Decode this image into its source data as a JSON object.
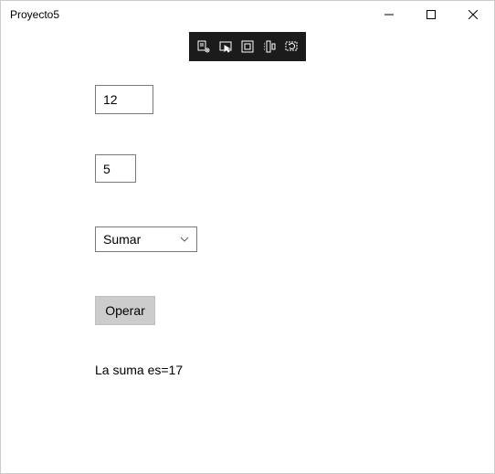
{
  "window": {
    "title": "Proyecto5"
  },
  "inputs": {
    "num1": "12",
    "num2": "5"
  },
  "combo": {
    "selected": "Sumar"
  },
  "button": {
    "label": "Operar"
  },
  "result": {
    "text": "La suma es=17"
  }
}
